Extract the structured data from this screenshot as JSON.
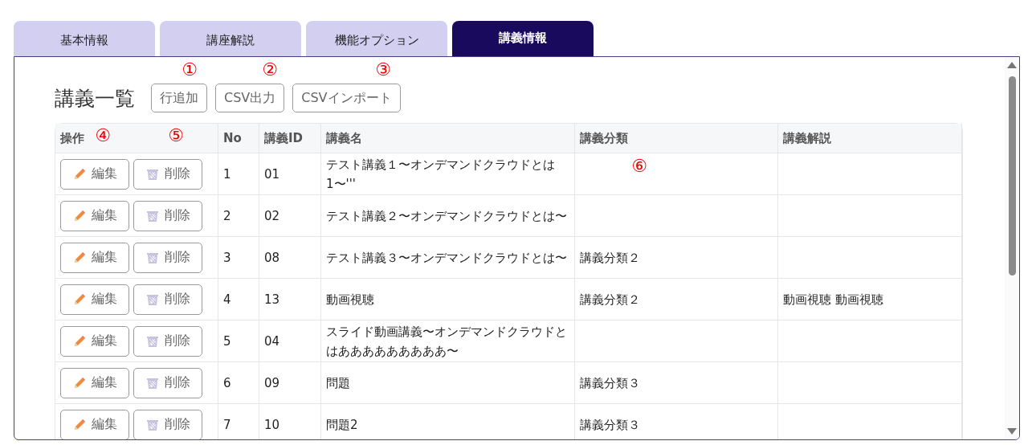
{
  "tabs": [
    {
      "label": "基本情報",
      "selected": false
    },
    {
      "label": "講座解説",
      "selected": false
    },
    {
      "label": "機能オプション",
      "selected": false
    },
    {
      "label": "講義情報",
      "selected": true
    }
  ],
  "heading": "講義一覧",
  "toolbar": [
    "行追加",
    "CSV出力",
    "CSVインポート"
  ],
  "annotations": [
    "①",
    "②",
    "③",
    "④",
    "⑤",
    "⑥"
  ],
  "table": {
    "columns": [
      "操作",
      "No",
      "講義ID",
      "講義名",
      "講義分類",
      "講義解説"
    ],
    "rows": [
      {
        "edit": "編集",
        "delete": "削除",
        "no": "1",
        "id": "01",
        "name": "テスト講義１〜オンデマンドクラウドとは1〜'''",
        "category": "",
        "description": ""
      },
      {
        "edit": "編集",
        "delete": "削除",
        "no": "2",
        "id": "02",
        "name": "テスト講義２〜オンデマンドクラウドとは〜",
        "category": "",
        "description": ""
      },
      {
        "edit": "編集",
        "delete": "削除",
        "no": "3",
        "id": "08",
        "name": "テスト講義３〜オンデマンドクラウドとは〜",
        "category": "講義分類２",
        "description": ""
      },
      {
        "edit": "編集",
        "delete": "削除",
        "no": "4",
        "id": "13",
        "name": "動画視聴",
        "category": "講義分類２",
        "description": "動画視聴 動画視聴"
      },
      {
        "edit": "編集",
        "delete": "削除",
        "no": "5",
        "id": "04",
        "name": "スライド動画講義〜オンデマンドクラウドとはあああああああああ〜",
        "category": "",
        "description": ""
      },
      {
        "edit": "編集",
        "delete": "削除",
        "no": "6",
        "id": "09",
        "name": "問題",
        "category": "講義分類３",
        "description": ""
      },
      {
        "edit": "編集",
        "delete": "削除",
        "no": "7",
        "id": "10",
        "name": "問題2",
        "category": "講義分類３",
        "description": ""
      }
    ]
  }
}
